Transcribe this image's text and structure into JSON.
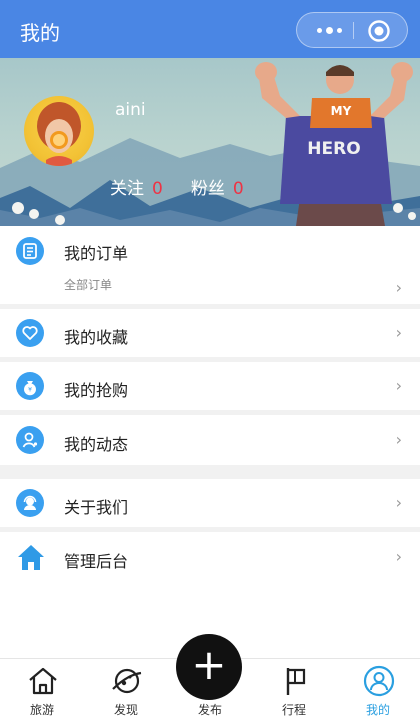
{
  "topbar": {
    "title": "我的"
  },
  "profile": {
    "username": "aini",
    "following_label": "关注",
    "following_count": "0",
    "followers_label": "粉丝",
    "followers_count": "0"
  },
  "menu": {
    "orders": {
      "label": "我的订单",
      "sub": "全部订单",
      "icon": "order-list-icon"
    },
    "favorites": {
      "label": "我的收藏",
      "icon": "heart-icon"
    },
    "flash": {
      "label": "我的抢购",
      "icon": "money-bag-icon"
    },
    "activity": {
      "label": "我的动态",
      "icon": "person-icon"
    },
    "about": {
      "label": "关于我们",
      "icon": "support-agent-icon"
    },
    "admin": {
      "label": "管理后台",
      "icon": "home-icon"
    }
  },
  "tabs": [
    {
      "label": "旅游",
      "icon": "home-icon"
    },
    {
      "label": "发现",
      "icon": "planet-icon"
    },
    {
      "label": "发布",
      "icon": "plus-icon"
    },
    {
      "label": "行程",
      "icon": "flag-icon"
    },
    {
      "label": "我的",
      "icon": "user-circle-icon"
    }
  ],
  "colors": {
    "header": "#4a86e4",
    "accent": "#2a9fe0",
    "count": "#ee3344",
    "icon": "#3aa0f0"
  },
  "banner_art": {
    "shirt_text": "HERO",
    "cap_text": "MY"
  }
}
